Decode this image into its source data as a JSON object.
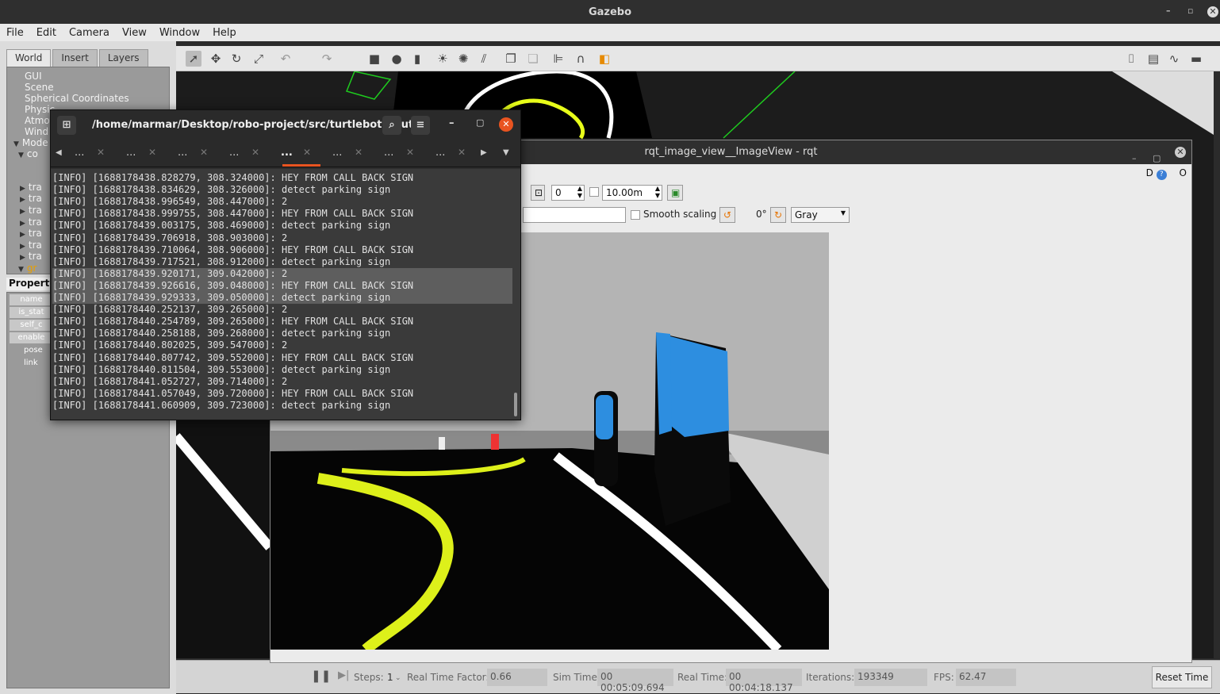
{
  "gazebo": {
    "title": "Gazebo",
    "menu": [
      "File",
      "Edit",
      "Camera",
      "View",
      "Window",
      "Help"
    ],
    "left_tabs": [
      "World",
      "Insert",
      "Layers"
    ],
    "tree": [
      {
        "label": "GUI",
        "arrow": ""
      },
      {
        "label": "Scene",
        "arrow": ""
      },
      {
        "label": "Spherical Coordinates",
        "arrow": ""
      },
      {
        "label": "Physic",
        "arrow": ""
      },
      {
        "label": "Atmo",
        "arrow": ""
      },
      {
        "label": "Wind",
        "arrow": ""
      },
      {
        "label": "Mode",
        "arrow": "▼"
      },
      {
        "label": "co",
        "arrow": "▼"
      },
      {
        "label": "tra",
        "arrow": "▶"
      },
      {
        "label": "tra",
        "arrow": "▶"
      },
      {
        "label": "tra",
        "arrow": "▶"
      },
      {
        "label": "tra",
        "arrow": "▶"
      },
      {
        "label": "tra",
        "arrow": "▶"
      },
      {
        "label": "tra",
        "arrow": "▶"
      },
      {
        "label": "tra",
        "arrow": "▶"
      },
      {
        "label": "gr",
        "arrow": "▼"
      }
    ],
    "property_header": "Property",
    "properties": [
      "name",
      "is_stat",
      "self_c",
      "enable",
      "pose",
      "link"
    ],
    "status": {
      "steps_label": "Steps:",
      "steps_value": "1",
      "rtf_label": "Real Time Factor:",
      "rtf_value": "0.66",
      "sim_time_label": "Sim Time:",
      "sim_time_value": "00 00:05:09.694",
      "real_time_label": "Real Time:",
      "real_time_value": "00 00:04:18.137",
      "iterations_label": "Iterations:",
      "iterations_value": "193349",
      "fps_label": "FPS:",
      "fps_value": "62.47",
      "reset_label": "Reset Time"
    }
  },
  "rqt": {
    "title": "rqt_image_view__ImageView - rqt",
    "spin_value": "0",
    "distance_value": "10.00m",
    "smooth_label": "Smooth scaling",
    "rotation_value": "0°",
    "color_scheme": "Gray",
    "help_text": "D",
    "close_text": "O"
  },
  "terminal": {
    "title": "/home/marmar/Desktop/robo-project/src/turtlebot3_aut...",
    "tab_label": "...",
    "lines": [
      "[INFO] [1688178438.828279, 308.324000]: HEY FROM CALL BACK SIGN",
      "[INFO] [1688178438.834629, 308.326000]: detect parking sign",
      "[INFO] [1688178438.996549, 308.447000]: 2",
      "[INFO] [1688178438.999755, 308.447000]: HEY FROM CALL BACK SIGN",
      "[INFO] [1688178439.003175, 308.469000]: detect parking sign",
      "[INFO] [1688178439.706918, 308.903000]: 2",
      "[INFO] [1688178439.710064, 308.906000]: HEY FROM CALL BACK SIGN",
      "[INFO] [1688178439.717521, 308.912000]: detect parking sign",
      "[INFO] [1688178439.920171, 309.042000]: 2",
      "[INFO] [1688178439.926616, 309.048000]: HEY FROM CALL BACK SIGN",
      "[INFO] [1688178439.929333, 309.050000]: detect parking sign",
      "[INFO] [1688178440.252137, 309.265000]: 2",
      "[INFO] [1688178440.254789, 309.265000]: HEY FROM CALL BACK SIGN",
      "[INFO] [1688178440.258188, 309.268000]: detect parking sign",
      "[INFO] [1688178440.802025, 309.547000]: 2",
      "[INFO] [1688178440.807742, 309.552000]: HEY FROM CALL BACK SIGN",
      "[INFO] [1688178440.811504, 309.553000]: detect parking sign",
      "[INFO] [1688178441.052727, 309.714000]: 2",
      "[INFO] [1688178441.057049, 309.720000]: HEY FROM CALL BACK SIGN",
      "[INFO] [1688178441.060909, 309.723000]: detect parking sign"
    ],
    "selected_lines": [
      8,
      9,
      10
    ]
  }
}
